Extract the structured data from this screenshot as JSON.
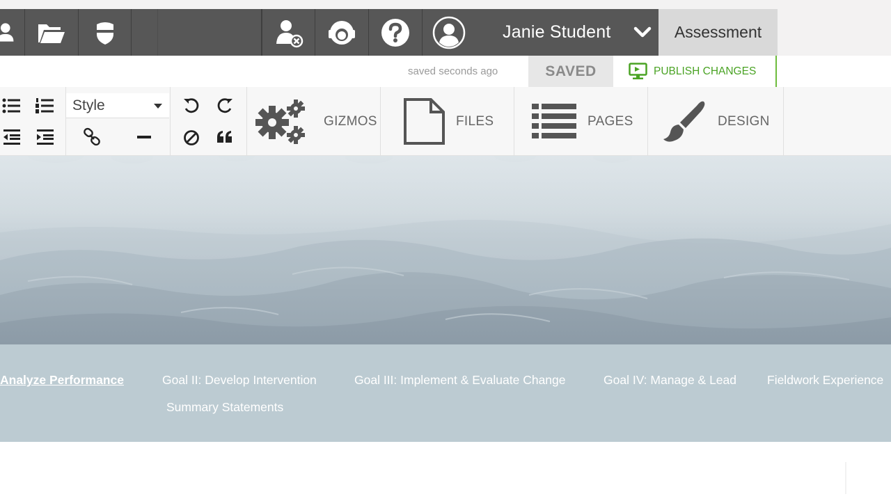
{
  "topbar": {
    "user_name": "Janie Student",
    "assessment_label": "Assessment",
    "icons": [
      "user-group-icon",
      "folder-icon",
      "badge-icon",
      "remove-user-icon",
      "support-agent-icon",
      "help-icon",
      "avatar-icon",
      "chevron-down-icon"
    ]
  },
  "status": {
    "saved_ago": "saved seconds ago",
    "saved_label": "SAVED",
    "publish_label": "PUBLISH CHANGES"
  },
  "toolbar": {
    "style_value": "Style",
    "gizmos_label": "GIZMOS",
    "files_label": "FILES",
    "pages_label": "PAGES",
    "design_label": "DESIGN"
  },
  "nav": {
    "items": [
      "Analyze Performance",
      "Goal II: Develop Intervention",
      "Goal III: Implement & Evaluate Change",
      "Goal IV: Manage & Lead",
      "Fieldwork Experience",
      "Summary Statements"
    ]
  },
  "colors": {
    "topbar": "#575757",
    "publish_green": "#4aa324",
    "nav_bg": "#bccbd2"
  }
}
